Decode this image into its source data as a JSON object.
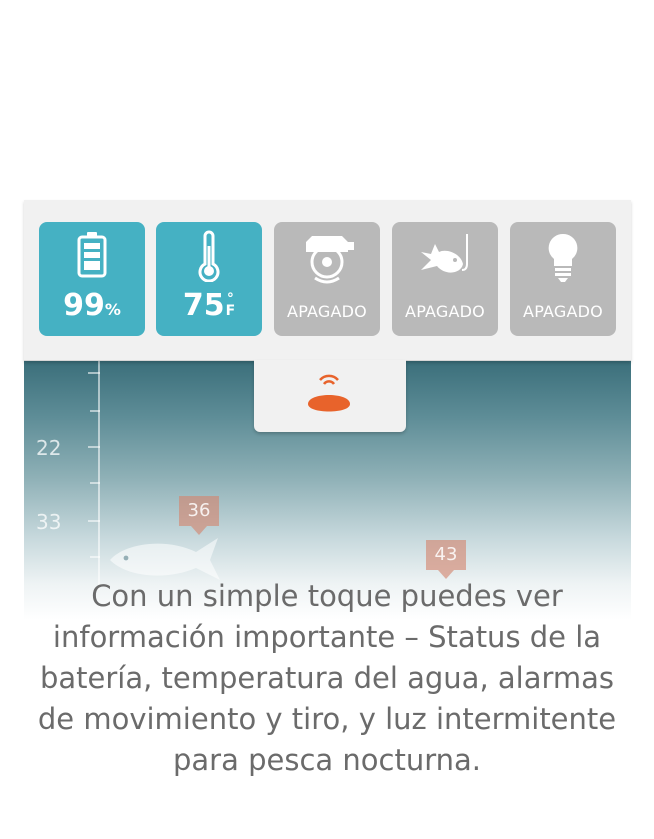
{
  "status_tiles": [
    {
      "name": "battery",
      "icon": "battery-icon",
      "value": "99",
      "unit": "%",
      "active": true
    },
    {
      "name": "water-temperature",
      "icon": "thermometer-icon",
      "value": "75",
      "unit_deg": "°",
      "unit": "F",
      "active": true
    },
    {
      "name": "motion-alarm",
      "icon": "motion-alarm-icon",
      "label": "APAGADO",
      "active": false
    },
    {
      "name": "fish-alarm",
      "icon": "fish-alarm-icon",
      "label": "APAGADO",
      "active": false
    },
    {
      "name": "night-light",
      "icon": "light-bulb-icon",
      "label": "APAGADO",
      "active": false
    }
  ],
  "tab": {
    "icon": "sonar-device-icon"
  },
  "sonar": {
    "depth_labels": [
      "22",
      "33"
    ],
    "fish_tags": [
      "36",
      "43"
    ]
  },
  "caption": "Con un simple toque puedes ver información importante – Status de la batería, temperatura del agua, alarmas de movimiento y tiro, y luz intermitente para pesca nocturna.",
  "colors": {
    "active_tile": "#45b1c3",
    "inactive_tile": "#b9b9b9",
    "device_orange": "#e8632b",
    "caption_text": "#6b6b6b"
  }
}
